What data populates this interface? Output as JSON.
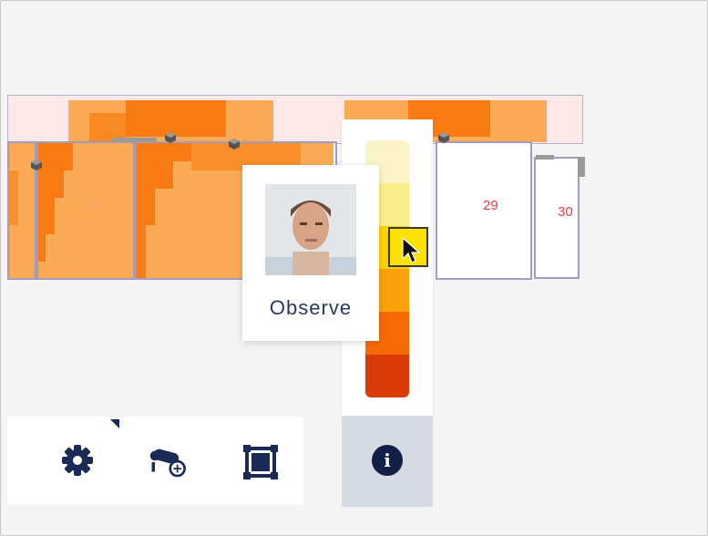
{
  "floorplan": {
    "rooms": [
      {
        "label": "",
        "heat": "orange"
      },
      {
        "label": "26",
        "heat": "orange"
      },
      {
        "label": "",
        "heat": "orange"
      },
      {
        "label": "29",
        "heat": "none"
      },
      {
        "label": "30",
        "heat": "none"
      }
    ]
  },
  "legend": {
    "colors": [
      "#fcf4c8",
      "#faee8c",
      "#fbd400",
      "#fba20d",
      "#f76a08",
      "#d83b05"
    ],
    "marker_color": "#ffe100",
    "info_icon_glyph": "i"
  },
  "popup": {
    "label": "Observe"
  },
  "toolbar": {
    "buttons": [
      "gear-icon",
      "camera-add-icon",
      "frame-icon"
    ]
  },
  "colors": {
    "accent": "#1b2a55",
    "room_label": "#ef3b45",
    "heat_light": "#fbab55",
    "heat_dark": "#f77a12",
    "corridor": "#fde9ea"
  }
}
